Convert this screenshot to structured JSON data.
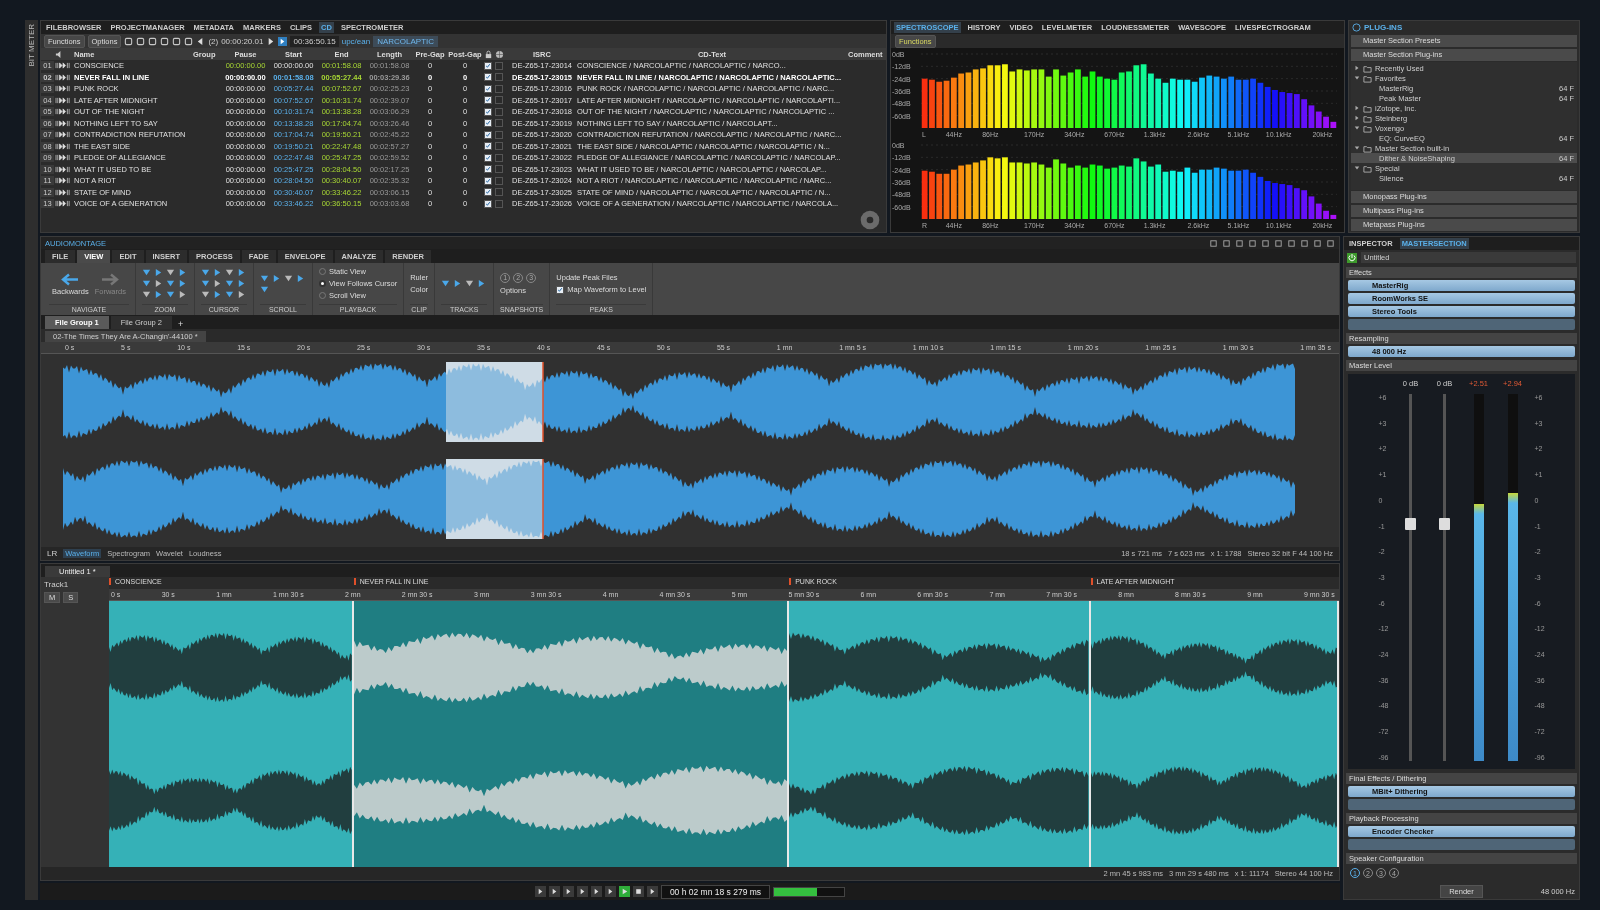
{
  "side_strip": {
    "label": "BIT METER"
  },
  "cd_panel": {
    "tabs": [
      {
        "label": "FILEBROWSER",
        "selected": false
      },
      {
        "label": "PROJECTMANAGER",
        "selected": false
      },
      {
        "label": "METADATA",
        "selected": false
      },
      {
        "label": "MARKERS",
        "selected": false
      },
      {
        "label": "CLIPS",
        "selected": false
      },
      {
        "label": "CD",
        "selected": true
      },
      {
        "label": "SPECTROMETER",
        "selected": false
      }
    ],
    "toolbar": {
      "functions": "Functions",
      "options": "Options",
      "track_index": "(2)",
      "position": "00:00:20.01",
      "total": "00:36:50.15",
      "upc": "upc/ean",
      "album": "NARCOLAPTIC"
    },
    "columns": [
      "Name",
      "Group",
      "Pause",
      "Start",
      "End",
      "Length",
      "Pre-Gap",
      "Post-Gap",
      "ISRC",
      "CD-Text",
      "Comment"
    ],
    "rows": [
      {
        "number": "01",
        "name": "CONSCIENCE",
        "pause": "00:00:00.00",
        "start": "00:00:00.00",
        "end": "00:01:58.08",
        "length": "00:01:58.08",
        "pre_gap": "0",
        "post_gap": "0",
        "lock_checked": true,
        "globe_checked": false,
        "isrc": "DE-Z65-17-23014",
        "cd_text": "CONSCIENCE / NARCOLAPTIC / NARCOLAPTIC / NARCO...",
        "selected": false
      },
      {
        "number": "02",
        "name": "NEVER FALL IN LINE",
        "pause": "00:00:00.00",
        "start": "00:01:58.08",
        "end": "00:05:27.44",
        "length": "00:03:29.36",
        "pre_gap": "0",
        "post_gap": "0",
        "lock_checked": true,
        "globe_checked": false,
        "isrc": "DE-Z65-17-23015",
        "cd_text": "NEVER FALL IN LINE / NARCOLAPTIC / NARCOLAPTIC / NARCOLAPTIC...",
        "selected": true
      },
      {
        "number": "03",
        "name": "PUNK ROCK",
        "pause": "00:00:00.00",
        "start": "00:05:27.44",
        "end": "00:07:52.67",
        "length": "00:02:25.23",
        "pre_gap": "0",
        "post_gap": "0",
        "lock_checked": true,
        "globe_checked": false,
        "isrc": "DE-Z65-17-23016",
        "cd_text": "PUNK ROCK / NARCOLAPTIC / NARCOLAPTIC / NARCOLAPTIC / NARC...",
        "selected": false
      },
      {
        "number": "04",
        "name": "LATE AFTER MIDNIGHT",
        "pause": "00:00:00.00",
        "start": "00:07:52.67",
        "end": "00:10:31.74",
        "length": "00:02:39.07",
        "pre_gap": "0",
        "post_gap": "0",
        "lock_checked": true,
        "globe_checked": false,
        "isrc": "DE-Z65-17-23017",
        "cd_text": "LATE AFTER MIDNIGHT / NARCOLAPTIC / NARCOLAPTIC / NARCOLAPTI...",
        "selected": false
      },
      {
        "number": "05",
        "name": "OUT OF THE NIGHT",
        "pause": "00:00:00.00",
        "start": "00:10:31.74",
        "end": "00:13:38.28",
        "length": "00:03:06.29",
        "pre_gap": "0",
        "post_gap": "0",
        "lock_checked": true,
        "globe_checked": false,
        "isrc": "DE-Z65-17-23018",
        "cd_text": "OUT OF THE NIGHT / NARCOLAPTIC / NARCOLAPTIC / NARCOLAPTIC ...",
        "selected": false
      },
      {
        "number": "06",
        "name": "NOTHING LEFT TO SAY",
        "pause": "00:00:00.00",
        "start": "00:13:38.28",
        "end": "00:17:04.74",
        "length": "00:03:26.46",
        "pre_gap": "0",
        "post_gap": "0",
        "lock_checked": true,
        "globe_checked": false,
        "isrc": "DE-Z65-17-23019",
        "cd_text": "NOTHING LEFT TO SAY / NARCOLAPTIC / NARCOLAPT...",
        "selected": false
      },
      {
        "number": "07",
        "name": "CONTRADICTION REFUTATION",
        "pause": "00:00:00.00",
        "start": "00:17:04.74",
        "end": "00:19:50.21",
        "length": "00:02:45.22",
        "pre_gap": "0",
        "post_gap": "0",
        "lock_checked": true,
        "globe_checked": false,
        "isrc": "DE-Z65-17-23020",
        "cd_text": "CONTRADICTION REFUTATION / NARCOLAPTIC / NARCOLAPTIC / NARC...",
        "selected": false
      },
      {
        "number": "08",
        "name": "THE EAST SIDE",
        "pause": "00:00:00.00",
        "start": "00:19:50.21",
        "end": "00:22:47.48",
        "length": "00:02:57.27",
        "pre_gap": "0",
        "post_gap": "0",
        "lock_checked": true,
        "globe_checked": false,
        "isrc": "DE-Z65-17-23021",
        "cd_text": "THE EAST SIDE / NARCOLAPTIC / NARCOLAPTIC / NARCOLAPTIC / N...",
        "selected": false
      },
      {
        "number": "09",
        "name": "PLEDGE OF ALLEGIANCE",
        "pause": "00:00:00.00",
        "start": "00:22:47.48",
        "end": "00:25:47.25",
        "length": "00:02:59.52",
        "pre_gap": "0",
        "post_gap": "0",
        "lock_checked": true,
        "globe_checked": false,
        "isrc": "DE-Z65-17-23022",
        "cd_text": "PLEDGE OF ALLEGIANCE / NARCOLAPTIC / NARCOLAPTIC / NARCOLAP...",
        "selected": false
      },
      {
        "number": "10",
        "name": "WHAT IT USED TO BE",
        "pause": "00:00:00.00",
        "start": "00:25:47.25",
        "end": "00:28:04.50",
        "length": "00:02:17.25",
        "pre_gap": "0",
        "post_gap": "0",
        "lock_checked": true,
        "globe_checked": false,
        "isrc": "DE-Z65-17-23023",
        "cd_text": "WHAT IT USED TO BE / NARCOLAPTIC / NARCOLAPTIC / NARCOLAP...",
        "selected": false
      },
      {
        "number": "11",
        "name": "NOT A RIOT",
        "pause": "00:00:00.00",
        "start": "00:28:04.50",
        "end": "00:30:40.07",
        "length": "00:02:35.32",
        "pre_gap": "0",
        "post_gap": "0",
        "lock_checked": true,
        "globe_checked": false,
        "isrc": "DE-Z65-17-23024",
        "cd_text": "NOT A RIOT / NARCOLAPTIC / NARCOLAPTIC / NARCOLAPTIC / NARC...",
        "selected": false
      },
      {
        "number": "12",
        "name": "STATE OF MIND",
        "pause": "00:00:00.00",
        "start": "00:30:40.07",
        "end": "00:33:46.22",
        "length": "00:03:06.15",
        "pre_gap": "0",
        "post_gap": "0",
        "lock_checked": true,
        "globe_checked": false,
        "isrc": "DE-Z65-17-23025",
        "cd_text": "STATE OF MIND / NARCOLAPTIC / NARCOLAPTIC / NARCOLAPTIC / N...",
        "selected": false
      },
      {
        "number": "13",
        "name": "VOICE OF A GENERATION",
        "pause": "00:00:00.00",
        "start": "00:33:46.22",
        "end": "00:36:50.15",
        "length": "00:03:03.68",
        "pre_gap": "0",
        "post_gap": "0",
        "lock_checked": true,
        "globe_checked": false,
        "isrc": "DE-Z65-17-23026",
        "cd_text": "VOICE OF A GENERATION / NARCOLAPTIC / NARCOLAPTIC / NARCOLA...",
        "selected": false
      }
    ]
  },
  "spectroscope": {
    "tabs": [
      {
        "label": "SPECTROSCOPE",
        "selected": true
      },
      {
        "label": "HISTORY",
        "selected": false
      },
      {
        "label": "VIDEO",
        "selected": false
      },
      {
        "label": "LEVELMETER",
        "selected": false
      },
      {
        "label": "LOUDNESSMETER",
        "selected": false
      },
      {
        "label": "WAVESCOPE",
        "selected": false
      },
      {
        "label": "LIVESPECTROGRAM",
        "selected": false
      }
    ],
    "functions": "Functions",
    "channels": [
      {
        "name": "L",
        "db_labels": [
          "0dB",
          "-12dB",
          "-24dB",
          "-36dB",
          "-48dB",
          "-60dB"
        ],
        "freq_labels": [
          "44Hz",
          "86Hz",
          "170Hz",
          "340Hz",
          "670Hz",
          "1.3kHz",
          "2.6kHz",
          "5.1kHz",
          "10.1kHz",
          "20kHz"
        ]
      },
      {
        "name": "R",
        "db_labels": [
          "0dB",
          "-12dB",
          "-24dB",
          "-36dB",
          "-48dB",
          "-60dB"
        ],
        "freq_labels": [
          "44Hz",
          "86Hz",
          "170Hz",
          "340Hz",
          "670Hz",
          "1.3kHz",
          "2.6kHz",
          "5.1kHz",
          "10.1kHz",
          "20kHz"
        ]
      }
    ]
  },
  "plugins": {
    "title": "PLUG-INS",
    "top_sections": [
      "Master Section Presets",
      "Master Section Plug-ins"
    ],
    "tree": [
      {
        "label": "Recently Used",
        "expanded": false
      },
      {
        "label": "Favorites",
        "expanded": true,
        "children": [
          {
            "label": "MasterRig",
            "format": "64 F",
            "selected": false
          },
          {
            "label": "Peak Master",
            "format": "64 F",
            "selected": false
          }
        ]
      },
      {
        "label": "iZotope, Inc.",
        "expanded": false
      },
      {
        "label": "Steinberg",
        "expanded": false
      },
      {
        "label": "Voxengo",
        "expanded": true,
        "children": [
          {
            "label": "EQ: CurveEQ",
            "format": "64 F",
            "selected": false
          }
        ]
      },
      {
        "label": "Master Section built-in",
        "expanded": true,
        "children": [
          {
            "label": "Dither & NoiseShaping",
            "format": "64 F",
            "selected": true
          }
        ]
      },
      {
        "label": "Special",
        "expanded": true,
        "children": [
          {
            "label": "Silence",
            "format": "64 F",
            "selected": false
          }
        ]
      }
    ],
    "bottom_sections": [
      "Monopass Plug-ins",
      "Multipass Plug-ins",
      "Metapass Plug-ins"
    ]
  },
  "audio_montage": {
    "title": "AUDIOMONTAGE",
    "ribbon_tabs": [
      {
        "label": "FILE",
        "selected": false
      },
      {
        "label": "VIEW",
        "selected": true
      },
      {
        "label": "EDIT",
        "selected": false
      },
      {
        "label": "INSERT",
        "selected": false
      },
      {
        "label": "PROCESS",
        "selected": false
      },
      {
        "label": "FADE",
        "selected": false
      },
      {
        "label": "ENVELOPE",
        "selected": false
      },
      {
        "label": "ANALYZE",
        "selected": false
      },
      {
        "label": "RENDER",
        "selected": false
      }
    ],
    "ribbon_groups": [
      {
        "kind": "navigate",
        "label": "NAVIGATE",
        "buttons": [
          {
            "label": "Backwards",
            "disabled": false
          },
          {
            "label": "Forwards",
            "disabled": true
          }
        ]
      },
      {
        "kind": "icons",
        "label": "ZOOM"
      },
      {
        "kind": "icons",
        "label": "CURSOR"
      },
      {
        "kind": "icons",
        "label": "SCROLL"
      },
      {
        "kind": "radios",
        "label": "PLAYBACK",
        "options": [
          {
            "label": "Static View",
            "selected": false
          },
          {
            "label": "View Follows Cursor",
            "selected": true
          },
          {
            "label": "Scroll View",
            "selected": false
          }
        ]
      },
      {
        "kind": "clip",
        "label": "CLIP",
        "items": [
          "Ruler",
          "Color"
        ]
      },
      {
        "kind": "icons",
        "label": "TRACKS"
      },
      {
        "kind": "snapshots",
        "label": "SNAPSHOTS",
        "numbers": [
          "1",
          "2",
          "3"
        ],
        "items": [
          "Options"
        ]
      },
      {
        "kind": "peaks",
        "label": "PEAKS",
        "button": "Update Peak Files",
        "checkbox": {
          "label": "Map Waveform to Level",
          "checked": true
        }
      }
    ],
    "file_groups": [
      {
        "label": "File Group 1",
        "selected": true
      },
      {
        "label": "File Group 2",
        "selected": false
      }
    ],
    "add_tab": "+",
    "wave_tab": "02-The Times They Are A-Changin'-44100 *",
    "wave_ruler": [
      "0 s",
      "5 s",
      "10 s",
      "15 s",
      "20 s",
      "25 s",
      "30 s",
      "35 s",
      "40 s",
      "45 s",
      "50 s",
      "55 s",
      "1 mn",
      "1 mn 5 s",
      "1 mn 10 s",
      "1 mn 15 s",
      "1 mn 20 s",
      "1 mn 25 s",
      "1 mn 30 s",
      "1 mn 35 s"
    ],
    "channel_label": "LR",
    "view_tabs": [
      {
        "label": "Waveform",
        "selected": true
      },
      {
        "label": "Spectrogram",
        "selected": false
      },
      {
        "label": "Wavelet",
        "selected": false
      },
      {
        "label": "Loudness",
        "selected": false
      }
    ],
    "wave_status": [
      "18 s 721 ms",
      "7 s 623 ms",
      "x 1: 1788",
      "Stereo 32 bit F 44 100 Hz"
    ]
  },
  "montage": {
    "tab": "Untitled 1 *",
    "markers": [
      "CONSCIENCE",
      "NEVER FALL IN LINE",
      "PUNK ROCK",
      "LATE AFTER MIDNIGHT"
    ],
    "ruler": [
      "0 s",
      "30 s",
      "1 mn",
      "1 mn 30 s",
      "2 mn",
      "2 mn 30 s",
      "3 mn",
      "3 mn 30 s",
      "4 mn",
      "4 mn 30 s",
      "5 mn",
      "5 mn 30 s",
      "6 mn",
      "6 mn 30 s",
      "7 mn",
      "7 mn 30 s",
      "8 mn",
      "8 mn 30 s",
      "9 mn",
      "9 mn 30 s"
    ],
    "track": {
      "name": "Track1",
      "mute": "M",
      "solo": "S"
    },
    "clips": [
      {
        "selected": false
      },
      {
        "selected": true
      },
      {
        "selected": false
      },
      {
        "selected": false
      }
    ],
    "status": [
      "2 mn 45 s 983 ms",
      "3 mn 29 s 480 ms",
      "x 1: 11174",
      "Stereo 44 100 Hz"
    ]
  },
  "transport": {
    "time": "00 h 02 mn 18 s 279 ms",
    "level": 0.62
  },
  "inspector": {
    "tabs": [
      {
        "label": "INSPECTOR",
        "selected": false
      },
      {
        "label": "MASTERSECTION",
        "selected": true
      }
    ],
    "preset": "Untitled",
    "effects_title": "Effects",
    "effects": [
      "MasterRig",
      "RoomWorks SE",
      "Stereo Tools"
    ],
    "resampling_title": "Resampling",
    "resampling": "48 000 Hz",
    "master_title": "Master Level",
    "level_columns": [
      {
        "kind": "fader",
        "value": "0 dB",
        "level": 0.63
      },
      {
        "kind": "fader",
        "value": "0 dB",
        "level": 0.63
      },
      {
        "kind": "meter",
        "value": "+2.51",
        "level": 0.7
      },
      {
        "kind": "meter",
        "value": "+2.94",
        "level": 0.73
      }
    ],
    "left_scale": [
      "+6",
      "+3",
      "+2",
      "+1",
      "0",
      "-1",
      "-2",
      "-3",
      "-6",
      "-12",
      "-24",
      "-36",
      "-48",
      "-72",
      "-96"
    ],
    "right_scale": [
      "+6",
      "+3",
      "+2",
      "+1",
      "0",
      "-1",
      "-2",
      "-3",
      "-6",
      "-12",
      "-24",
      "-36",
      "-48",
      "-72",
      "-96"
    ],
    "final_title": "Final Effects / Dithering",
    "final_effects": [
      "MBit+ Dithering"
    ],
    "playback_title": "Playback Processing",
    "playback_effects": [
      "Encoder Checker"
    ],
    "speaker_title": "Speaker Configuration",
    "speakers": [
      {
        "label": "1",
        "selected": true
      },
      {
        "label": "2",
        "selected": false
      },
      {
        "label": "3",
        "selected": false
      },
      {
        "label": "4",
        "selected": false
      }
    ],
    "render": "Render",
    "sample_rate": "48 000 Hz"
  }
}
